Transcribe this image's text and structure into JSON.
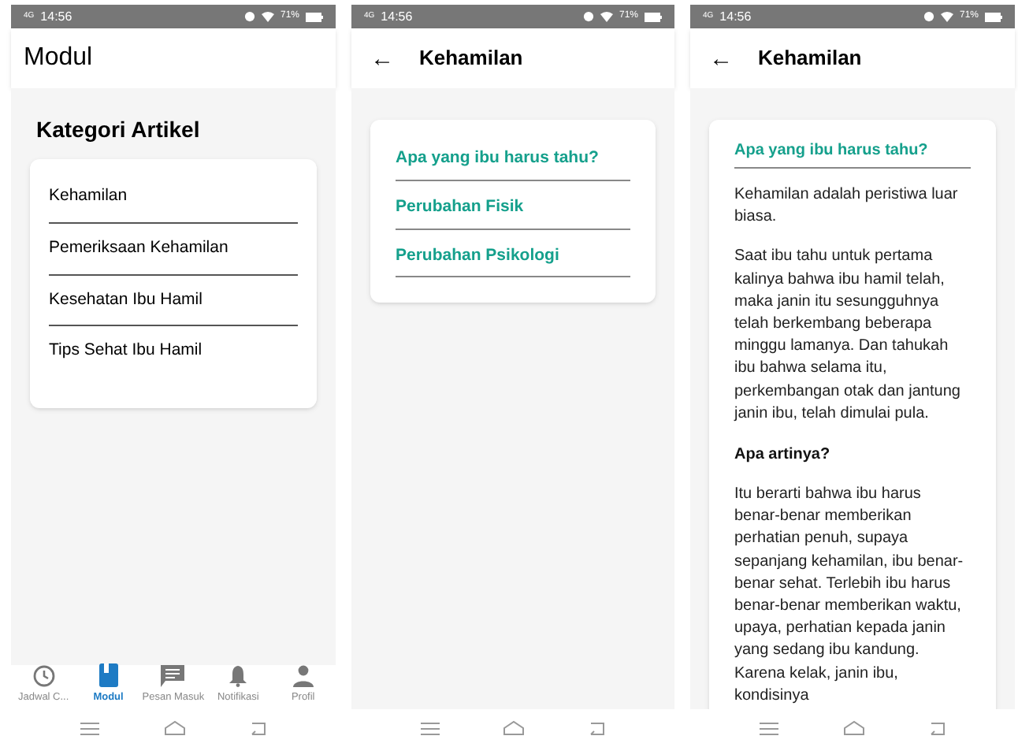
{
  "screens": [
    {
      "kind": "menu",
      "status_bar": {
        "network": "4G",
        "time": "14:56",
        "battery": "71%"
      },
      "title": "Modul",
      "section_title": "Kategori Artikel",
      "items": [
        "Kehamilan",
        "Pemeriksaan Kehamilan",
        "Kesehatan Ibu Hamil",
        "Tips Sehat Ibu Hamil"
      ],
      "bottom_nav": [
        {
          "label": "Jadwal C...",
          "kind": "clock",
          "selected": false
        },
        {
          "label": "Modul",
          "kind": "book",
          "selected": true
        },
        {
          "label": "Pesan Masuk",
          "kind": "message",
          "selected": false
        },
        {
          "label": "Notifikasi",
          "kind": "bell",
          "selected": false
        },
        {
          "label": "Profil",
          "kind": "person",
          "selected": false
        }
      ]
    },
    {
      "kind": "links",
      "status_bar": {
        "network": "4G",
        "time": "14:56",
        "battery": "71%"
      },
      "title": "Kehamilan",
      "back": "←",
      "links": [
        "Apa yang ibu harus tahu?",
        "Perubahan Fisik",
        "Perubahan Psikologi"
      ]
    },
    {
      "kind": "article",
      "status_bar": {
        "network": "4G",
        "time": "14:56",
        "battery": "71%"
      },
      "title": "Kehamilan",
      "back": "←",
      "heading": "Apa yang ibu harus tahu?",
      "blocks": [
        {
          "kind": "paragraph",
          "text": "Kehamilan adalah peristiwa luar biasa."
        },
        {
          "kind": "paragraph",
          "text": "Saat ibu tahu untuk pertama kalinya bahwa ibu hamil telah, maka janin itu sesungguhnya telah berkembang beberapa minggu lamanya. Dan tahukah ibu bahwa selama itu, perkembangan otak dan jantung janin ibu, telah dimulai pula."
        },
        {
          "kind": "subheading",
          "text": "Apa artinya?"
        },
        {
          "kind": "paragraph",
          "text": "Itu berarti bahwa ibu harus benar-benar memberikan perhatian penuh, supaya sepanjang kehamilan, ibu benar-benar sehat. Terlebih ibu harus benar-benar memberikan waktu, upaya, perhatian kepada janin yang sedang ibu kandung. Karena kelak, janin ibu, kondisinya"
        }
      ]
    }
  ]
}
